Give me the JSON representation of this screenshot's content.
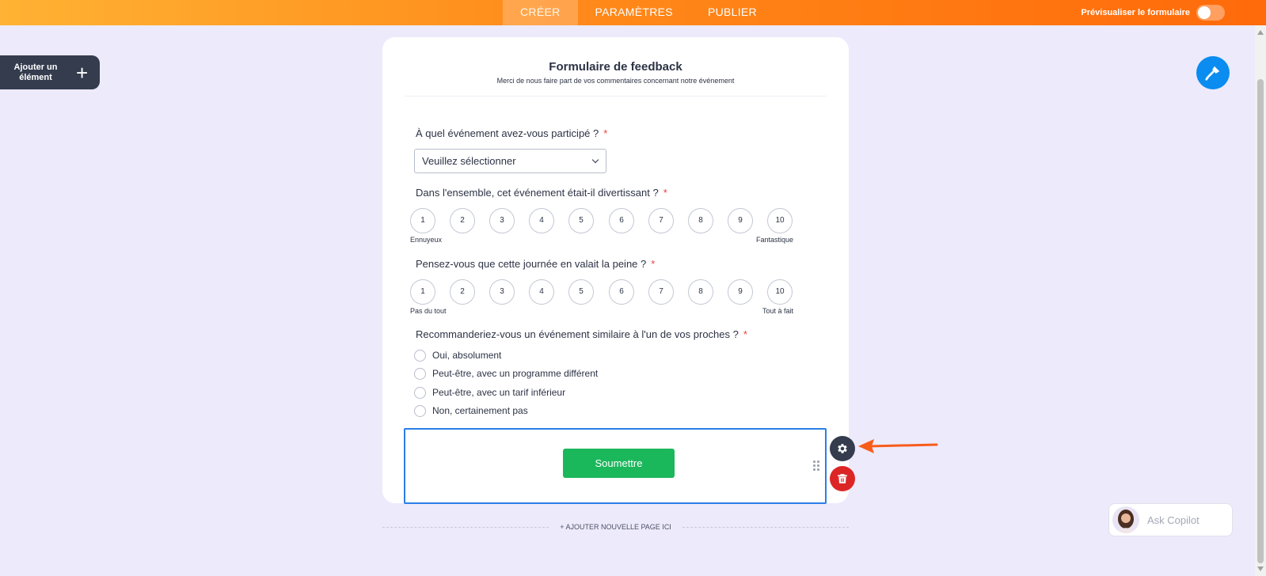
{
  "topbar": {
    "tabs": [
      {
        "label": "CRÉER",
        "active": true
      },
      {
        "label": "PARAMÈTRES",
        "active": false
      },
      {
        "label": "PUBLIER",
        "active": false
      }
    ],
    "preview_label": "Prévisualiser le formulaire",
    "preview_enabled": false
  },
  "sidebar": {
    "add_element_label": "Ajouter un élément",
    "add_icon": "plus-icon"
  },
  "design_button": {
    "icon": "paint-roller-icon",
    "color": "#0a8cf0"
  },
  "form": {
    "title": "Formulaire de feedback",
    "subtitle": "Merci de nous faire part de vos commentaires concernant notre événement",
    "questions": [
      {
        "label": "À quel événement avez-vous participé ?",
        "required_mark": "*",
        "type": "dropdown",
        "placeholder": "Veuillez sélectionner"
      },
      {
        "label": "Dans l'ensemble, cet événement était-il divertissant ?",
        "required_mark": "*",
        "type": "scale",
        "options": [
          "1",
          "2",
          "3",
          "4",
          "5",
          "6",
          "7",
          "8",
          "9",
          "10"
        ],
        "low_label": "Ennuyeux",
        "high_label": "Fantastique"
      },
      {
        "label": "Pensez-vous que cette journée en valait la peine ?",
        "required_mark": "*",
        "type": "scale",
        "options": [
          "1",
          "2",
          "3",
          "4",
          "5",
          "6",
          "7",
          "8",
          "9",
          "10"
        ],
        "low_label": "Pas du tout",
        "high_label": "Tout à fait"
      },
      {
        "label": "Recommanderiez-vous un événement similaire à l'un de vos proches ?",
        "required_mark": "*",
        "type": "radio",
        "options": [
          "Oui, absolument",
          "Peut-être, avec un programme différent",
          "Peut-être, avec un tarif inférieur",
          "Non, certainement pas"
        ]
      }
    ],
    "submit_label": "Soumettre",
    "submit_color": "#1bb75b"
  },
  "element_actions": {
    "settings_icon": "gear-icon",
    "delete_icon": "trash-icon",
    "drag_icon": "drag-handle-icon"
  },
  "add_page_label": "+ AJOUTER NOUVELLE PAGE ICI",
  "copilot": {
    "placeholder": "Ask Copilot"
  },
  "colors": {
    "accent_orange": "#ff7a12",
    "required": "#f23a3c",
    "selection_blue": "#2a7ee8",
    "delete_red": "#dc2626"
  }
}
